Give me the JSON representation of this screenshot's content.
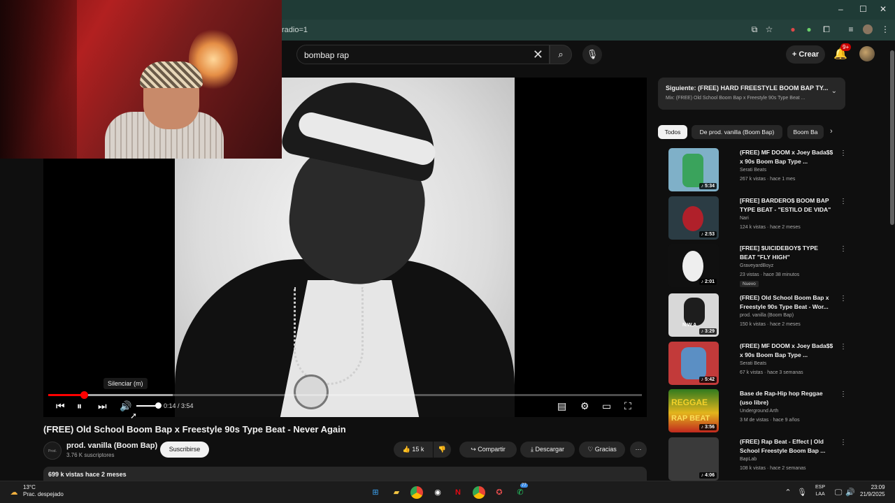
{
  "browser": {
    "url_fragment": "radio=1",
    "window_controls": [
      "–",
      "☐",
      "✕"
    ]
  },
  "youtube": {
    "search_query": "bombap rap",
    "create_label": "Crear",
    "notifications_badge": "9+"
  },
  "player": {
    "tooltip": "Silenciar (m)",
    "time_current": "0:14",
    "time_total": "3:54",
    "time_display": "0:14 / 3:54",
    "progress_fraction": 0.06,
    "buffer_fraction": 0.21,
    "volume_fraction": 1.0
  },
  "video": {
    "title": "(FREE) Old School Boom Bap x Freestyle 90s Type Beat - Never Again",
    "channel_name": "prod. vanilla (Boom Bap)",
    "subscribers": "3.76 K suscriptores",
    "subscribe_label": "Suscribirse",
    "likes": "15 k",
    "share_label": "Compartir",
    "download_label": "Descargar",
    "thanks_label": "Gracias",
    "views_date": "699 k vistas  hace 2 meses"
  },
  "sidebar": {
    "next_label": "Siguiente: (FREE) HARD FREESTYLE BOOM BAP TY...",
    "next_mix": "Mix: (FREE) Old School Boom Bap x Freestyle 90s Type Beat ...",
    "chips": [
      "Todos",
      "De prod. vanilla (Boom Bap)",
      "Boom Ba"
    ],
    "items": [
      {
        "title": "(FREE) MF DOOM x Joey Bada$$ x 90s Boom Bap Type ...",
        "channel": "Serati Beats",
        "meta": "267 k vistas · hace 1 mes",
        "duration": "5:34",
        "badge": "",
        "color": "#7fb0c8"
      },
      {
        "title": "[FREE] BARDERO$ BOOM BAP TYPE BEAT - \"ESTILO DE VIDA\"",
        "channel": "Nari",
        "meta": "124 k vistas · hace 2 meses",
        "duration": "2:53",
        "badge": "",
        "color": "#2b3c44"
      },
      {
        "title": "[FREE] $UICIDEBOY$ TYPE BEAT \"FLY HIGH\"",
        "channel": "GraveyardBoyz",
        "meta": "23 vistas · hace 38 minutos",
        "duration": "2:01",
        "badge": "Nuevo",
        "color": "#101010"
      },
      {
        "title": "(FREE) Old School Boom Bap x Freestyle 90s Type Beat - Wor...",
        "channel": "prod. vanilla (Boom Bap)",
        "meta": "150 k vistas · hace 2 meses",
        "duration": "3:29",
        "badge": "",
        "color": "#d8d8d8"
      },
      {
        "title": "(FREE) MF DOOM x Joey Bada$$ x 90s Boom Bap Type ...",
        "channel": "Serati Beats",
        "meta": "67 k vistas · hace 3 semanas",
        "duration": "5:42",
        "badge": "",
        "color": "#c23a3a"
      },
      {
        "title": "Base de Rap-Hip hop Reggae (uso libre)",
        "channel": "Underground Arth",
        "meta": "3 M de vistas · hace 9 años",
        "duration": "3:56",
        "badge": "",
        "color": "#2f7a1f"
      },
      {
        "title": "(FREE) Rap Beat - Effect | Old School Freestyle Boom Bap ...",
        "channel": "BapLab",
        "meta": "108 k vistas · hace 2 semanas",
        "duration": "4:06",
        "badge": "",
        "color": "#3a3a3a"
      }
    ],
    "reggae_text_1": "REGGAE",
    "reggae_text_2": "RAP BEAT"
  },
  "thumb_4_text": "N.W.A",
  "channel_logo_text": "Prod. Vanilla",
  "taskbar": {
    "temperature": "13°C",
    "weather": "Prac. despejado",
    "lang_1": "ESP",
    "lang_2": "LAA",
    "time": "23:09",
    "date": "21/9/2025",
    "whatsapp_badge": "77"
  }
}
